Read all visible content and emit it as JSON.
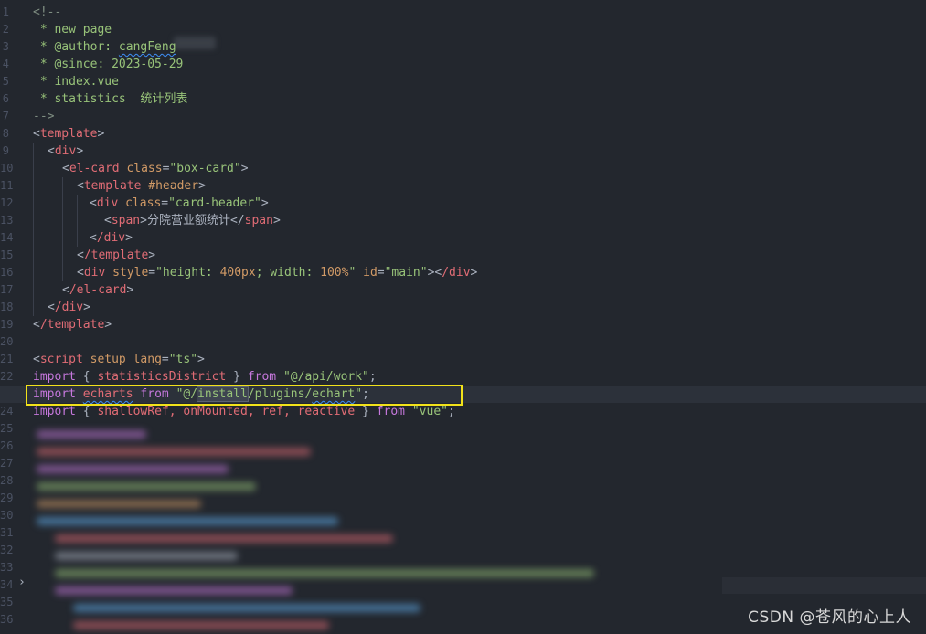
{
  "editor": {
    "language": "vue",
    "current_line": "23",
    "lines": [
      {
        "n": "1"
      },
      {
        "n": "2"
      },
      {
        "n": "3"
      },
      {
        "n": "4"
      },
      {
        "n": "5"
      },
      {
        "n": "6"
      },
      {
        "n": "7"
      },
      {
        "n": "8"
      },
      {
        "n": "9"
      },
      {
        "n": "10"
      },
      {
        "n": "11"
      },
      {
        "n": "12"
      },
      {
        "n": "13"
      },
      {
        "n": "14"
      },
      {
        "n": "15"
      },
      {
        "n": "16"
      },
      {
        "n": "17"
      },
      {
        "n": "18"
      },
      {
        "n": "19"
      },
      {
        "n": "20"
      },
      {
        "n": "21"
      },
      {
        "n": "22"
      },
      {
        "n": "23"
      },
      {
        "n": "24"
      },
      {
        "n": "25"
      },
      {
        "n": "26"
      },
      {
        "n": "27"
      },
      {
        "n": "28"
      },
      {
        "n": "29"
      },
      {
        "n": "30"
      },
      {
        "n": "31"
      },
      {
        "n": "32"
      },
      {
        "n": "33"
      },
      {
        "n": "34"
      },
      {
        "n": "35"
      },
      {
        "n": "36"
      }
    ],
    "code": {
      "l1": "<!--",
      "l2": " * new page",
      "l3_a": " * @author: ",
      "l3_b": "cangFeng",
      "l4": " * @since: 2023-05-29",
      "l5": " * index.vue",
      "l6": " * statistics  统计列表",
      "l7": "-->",
      "l8_tag": "template",
      "l9_tag": "div",
      "l10_tag": "el-card",
      "l10_attr": "class",
      "l10_val": "\"box-card\"",
      "l11_tag": "template",
      "l11_attr": "#header",
      "l12_tag": "div",
      "l12_attr": "class",
      "l12_val": "\"card-header\"",
      "l13_tag": "span",
      "l13_text": "分院营业额统计",
      "l14_tag": "/div",
      "l15_tag": "/template",
      "l16_tag": "div",
      "l16_attr1": "style",
      "l16_val1_a": "\"height: ",
      "l16_val1_num1": "400px",
      "l16_val1_b": "; width: ",
      "l16_val1_num2": "100%",
      "l16_val1_c": "\"",
      "l16_attr2": "id",
      "l16_val2": "\"main\"",
      "l16_close": "/div",
      "l17_tag": "/el-card",
      "l18_tag": "/div",
      "l19_tag": "/template",
      "l21_tag": "script",
      "l21_attr1": "setup",
      "l21_attr2": "lang",
      "l21_val": "\"ts\"",
      "l22_kw1": "import",
      "l22_names": "statisticsDistrict",
      "l22_kw2": "from",
      "l22_str": "\"@/api/work\"",
      "l23_kw1": "import",
      "l23_name": "echarts",
      "l23_kw2": "from",
      "l23_str_a": "\"@/",
      "l23_str_b": "install",
      "l23_str_c": "/plugins/",
      "l23_str_d": "echart",
      "l23_str_e": "\"",
      "l24_kw1": "import",
      "l24_names": "shallowRef, onMounted, ref, reactive",
      "l24_kw2": "from",
      "l24_str": "\"vue\""
    }
  },
  "watermark": "CSDN @苍风的心上人",
  "colors": {
    "background": "#23272e",
    "highlight_border": "#f2e21a",
    "tag": "#e06c75",
    "string": "#98c379",
    "keyword": "#c678dd",
    "attribute": "#d19a66"
  }
}
